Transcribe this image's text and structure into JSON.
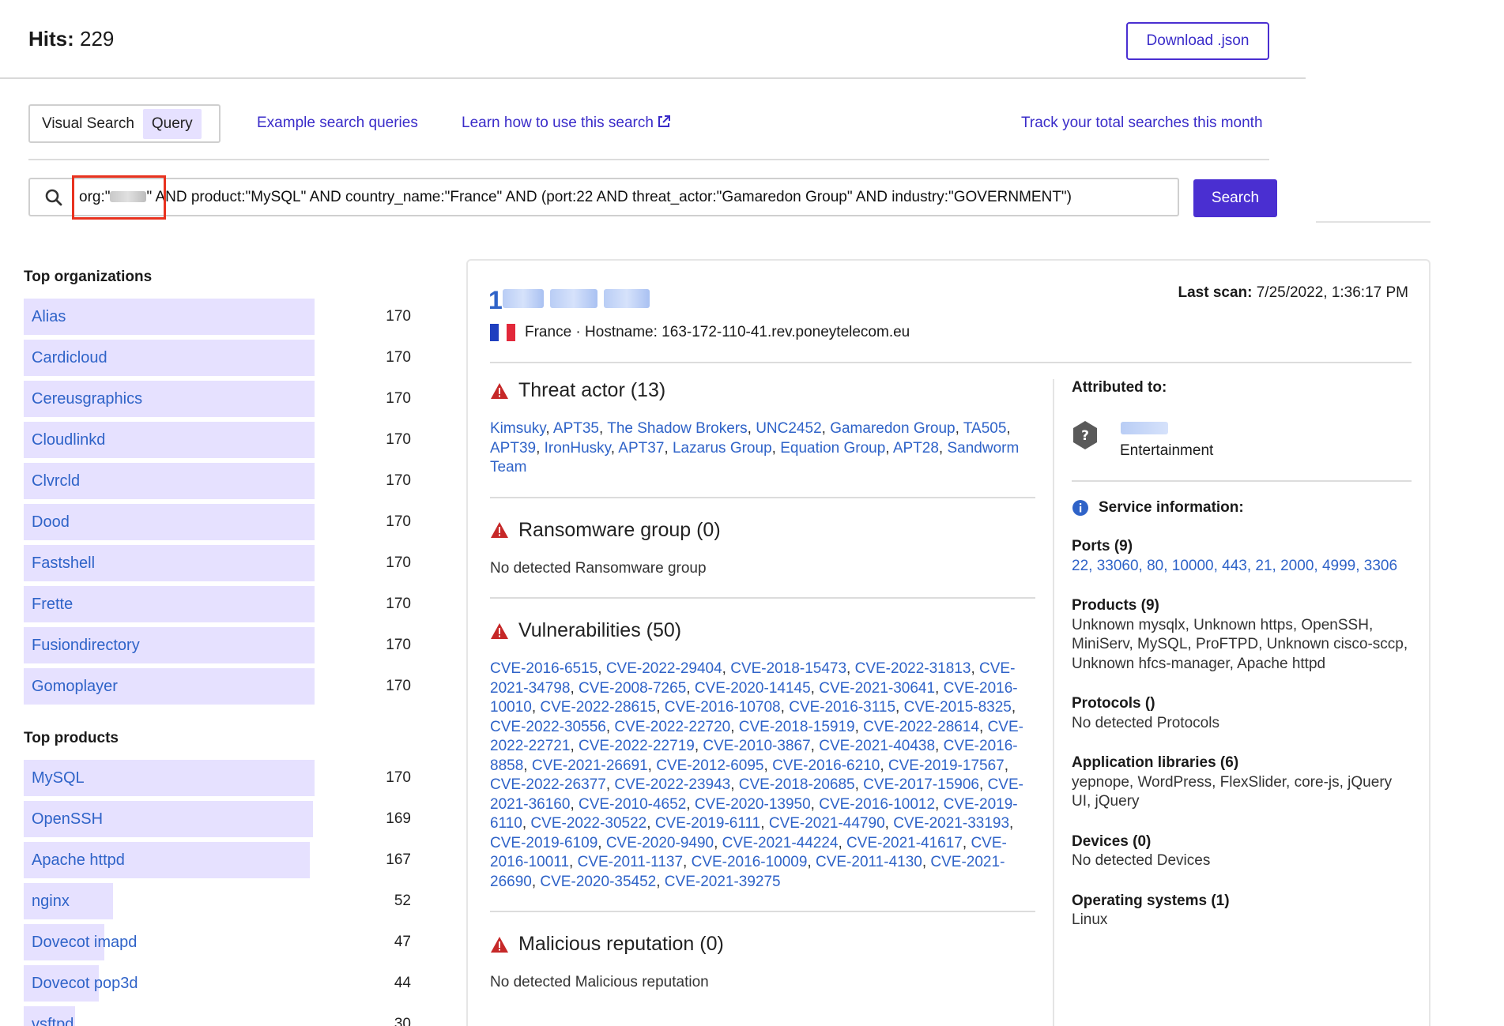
{
  "header": {
    "hits_label": "Hits:",
    "hits_value": "229",
    "download_label": "Download .json"
  },
  "nav": {
    "visual_search": "Visual Search",
    "query": "Query",
    "example_queries": "Example search queries",
    "learn_how": "Learn how to use this search",
    "track": "Track your total searches this month"
  },
  "search": {
    "query_prefix": "org:\"",
    "query_rest": "\" AND product:\"MySQL\" AND country_name:\"France\" AND (port:22 AND threat_actor:\"Gamaredon Group\" AND industry:\"GOVERNMENT\")",
    "button": "Search"
  },
  "top_organizations": {
    "title": "Top organizations",
    "max": 170,
    "items": [
      {
        "label": "Alias",
        "count": 170
      },
      {
        "label": "Cardicloud",
        "count": 170
      },
      {
        "label": "Cereusgraphics",
        "count": 170
      },
      {
        "label": "Cloudlinkd",
        "count": 170
      },
      {
        "label": "Clvrcld",
        "count": 170
      },
      {
        "label": "Dood",
        "count": 170
      },
      {
        "label": "Fastshell",
        "count": 170
      },
      {
        "label": "Frette",
        "count": 170
      },
      {
        "label": "Fusiondirectory",
        "count": 170
      },
      {
        "label": "Gomoplayer",
        "count": 170
      }
    ]
  },
  "top_products": {
    "title": "Top products",
    "max": 170,
    "items": [
      {
        "label": "MySQL",
        "count": 170
      },
      {
        "label": "OpenSSH",
        "count": 169
      },
      {
        "label": "Apache httpd",
        "count": 167
      },
      {
        "label": "nginx",
        "count": 52
      },
      {
        "label": "Dovecot imapd",
        "count": 47
      },
      {
        "label": "Dovecot pop3d",
        "count": 44
      },
      {
        "label": "vsftpd",
        "count": 30
      }
    ]
  },
  "result": {
    "ip_first_char": "1",
    "last_scan_label": "Last scan:",
    "last_scan_value": "7/25/2022, 1:36:17 PM",
    "country": "France",
    "hostname_text": "· Hostname: 163-172-110-41.rev.poneytelecom.eu",
    "threat_actor": {
      "title": "Threat actor (13)",
      "items": [
        "Kimsuky",
        "APT35",
        "The Shadow Brokers",
        "UNC2452",
        "Gamaredon Group",
        "TA505",
        "APT39",
        "IronHusky",
        "APT37",
        "Lazarus Group",
        "Equation Group",
        "APT28",
        "Sandworm Team"
      ]
    },
    "ransomware": {
      "title": "Ransomware group (0)",
      "empty": "No detected Ransomware group"
    },
    "vulnerabilities": {
      "title": "Vulnerabilities (50)",
      "items": [
        "CVE-2016-6515",
        "CVE-2022-29404",
        "CVE-2018-15473",
        "CVE-2022-31813",
        "CVE-2021-34798",
        "CVE-2008-7265",
        "CVE-2020-14145",
        "CVE-2021-30641",
        "CVE-2016-10010",
        "CVE-2022-28615",
        "CVE-2016-10708",
        "CVE-2016-3115",
        "CVE-2015-8325",
        "CVE-2022-30556",
        "CVE-2022-22720",
        "CVE-2018-15919",
        "CVE-2022-28614",
        "CVE-2022-22721",
        "CVE-2022-22719",
        "CVE-2010-3867",
        "CVE-2021-40438",
        "CVE-2016-8858",
        "CVE-2021-26691",
        "CVE-2012-6095",
        "CVE-2016-6210",
        "CVE-2019-17567",
        "CVE-2022-26377",
        "CVE-2022-23943",
        "CVE-2018-20685",
        "CVE-2017-15906",
        "CVE-2021-36160",
        "CVE-2010-4652",
        "CVE-2020-13950",
        "CVE-2016-10012",
        "CVE-2019-6110",
        "CVE-2022-30522",
        "CVE-2019-6111",
        "CVE-2021-44790",
        "CVE-2021-33193",
        "CVE-2019-6109",
        "CVE-2020-9490",
        "CVE-2021-44224",
        "CVE-2021-41617",
        "CVE-2016-10011",
        "CVE-2011-1137",
        "CVE-2016-10009",
        "CVE-2011-4130",
        "CVE-2021-26690",
        "CVE-2020-35452",
        "CVE-2021-39275"
      ]
    },
    "malicious": {
      "title": "Malicious reputation (0)",
      "empty": "No detected Malicious reputation"
    },
    "attributed": {
      "title": "Attributed to:",
      "industry": "Entertainment"
    },
    "service": {
      "title": "Service information:",
      "ports_title": "Ports (9)",
      "ports": "22, 33060, 80, 10000, 443, 21, 2000, 4999, 3306",
      "products_title": "Products (9)",
      "products": "Unknown mysqlx, Unknown https, OpenSSH, MiniServ, MySQL, ProFTPD, Unknown cisco-sccp, Unknown hfcs-manager, Apache httpd",
      "protocols_title": "Protocols ()",
      "protocols": "No detected Protocols",
      "libraries_title": "Application libraries (6)",
      "libraries": "yepnope, WordPress, FlexSlider, core-js, jQuery UI, jQuery",
      "devices_title": "Devices (0)",
      "devices": "No detected Devices",
      "os_title": "Operating systems (1)",
      "os": "Linux"
    }
  },
  "colors": {
    "accent": "#4a2fd1",
    "link": "#2f63c8",
    "bar": "#e6e1ff",
    "warning": "#c62828",
    "highlight": "#e8321f"
  }
}
